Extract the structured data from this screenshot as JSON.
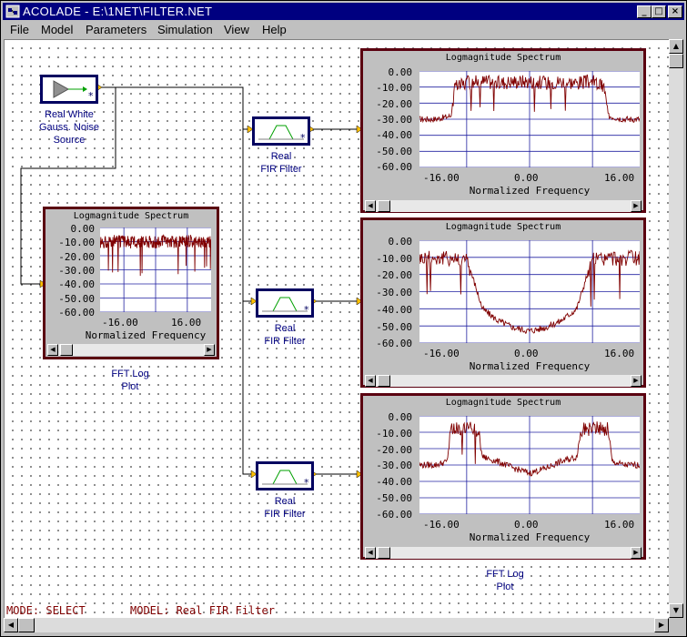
{
  "window": {
    "title": "ACOLADE - E:\\1NET\\FILTER.NET",
    "minimize_glyph": "_",
    "maximize_glyph": "□",
    "close_glyph": "×"
  },
  "menu": {
    "items": [
      "File",
      "Model",
      "Parameters",
      "Simulation",
      "View",
      "Help"
    ]
  },
  "blocks": {
    "noise_source": {
      "label_lines": [
        "Real White",
        "Gauss. Noise",
        "Source"
      ]
    },
    "fir1": {
      "label_lines": [
        "Real",
        "FIR Filter"
      ]
    },
    "fir2": {
      "label_lines": [
        "Real",
        "FIR Filter"
      ]
    },
    "fir3": {
      "label_lines": [
        "Real",
        "FIR Filter"
      ]
    },
    "fft_plot_left": {
      "label_lines": [
        "FFT Log",
        "Plot"
      ]
    },
    "fft_plot_bottom": {
      "label_lines": [
        "FFT Log",
        "Plot"
      ]
    }
  },
  "plot_common": {
    "title": "Logmagnitude Spectrum",
    "xlabel": "Normalized Frequency",
    "ytick_labels": [
      "0.00",
      "-10.00",
      "-20.00",
      "-30.00",
      "-40.00",
      "-50.00",
      "-60.00"
    ],
    "xtick_labels": [
      "-16.00",
      "0.00",
      "16.00"
    ],
    "xtick_labels_small": [
      "-16.00",
      "16.00"
    ]
  },
  "chart_data": [
    {
      "type": "line",
      "title": "Logmagnitude Spectrum",
      "xlabel": "Normalized Frequency",
      "ylabel": "",
      "xlim": [
        -28,
        28
      ],
      "ylim": [
        -60,
        0
      ],
      "grid": true,
      "x": [
        -28,
        -24,
        -20,
        -19,
        -16,
        -12,
        -8,
        -4,
        0,
        4,
        8,
        12,
        16,
        19,
        20,
        24,
        28
      ],
      "series": [
        {
          "values": [
            -30,
            -30,
            -28,
            -10,
            -7,
            -6,
            -7,
            -6,
            -6,
            -7,
            -6,
            -7,
            -6,
            -10,
            -28,
            -30,
            -30
          ]
        }
      ],
      "color": "#800000"
    },
    {
      "type": "line",
      "title": "Logmagnitude Spectrum",
      "xlabel": "Normalized Frequency",
      "ylabel": "",
      "xlim": [
        -28,
        28
      ],
      "ylim": [
        -60,
        0
      ],
      "grid": true,
      "x": [
        -28,
        -20,
        -16,
        -14,
        -12,
        -8,
        -4,
        0,
        4,
        8,
        12,
        14,
        16,
        20,
        28
      ],
      "series": [
        {
          "values": [
            -10,
            -10,
            -11,
            -25,
            -40,
            -47,
            -51,
            -53,
            -51,
            -47,
            -40,
            -25,
            -11,
            -10,
            -10
          ]
        }
      ],
      "color": "#800000"
    },
    {
      "type": "line",
      "title": "Logmagnitude Spectrum",
      "xlabel": "Normalized Frequency",
      "ylabel": "",
      "xlim": [
        -28,
        28
      ],
      "ylim": [
        -60,
        0
      ],
      "grid": true,
      "x": [
        -28,
        -24,
        -21,
        -20,
        -16,
        -13,
        -12,
        -8,
        -4,
        0,
        4,
        8,
        12,
        13,
        16,
        20,
        21,
        24,
        28
      ],
      "series": [
        {
          "values": [
            -30,
            -30,
            -28,
            -8,
            -7,
            -8,
            -25,
            -28,
            -32,
            -35,
            -32,
            -28,
            -25,
            -8,
            -7,
            -8,
            -28,
            -30,
            -30
          ]
        }
      ],
      "color": "#800000"
    },
    {
      "type": "line",
      "title": "Logmagnitude Spectrum",
      "xlabel": "Normalized Frequency",
      "ylabel": "",
      "xlim": [
        -28,
        28
      ],
      "ylim": [
        -60,
        0
      ],
      "grid": true,
      "x": [
        -28,
        -20,
        -12,
        -4,
        0,
        4,
        12,
        20,
        28
      ],
      "series": [
        {
          "values": [
            -10,
            -9,
            -10,
            -9,
            -10,
            -9,
            -10,
            -9,
            -10
          ]
        }
      ],
      "color": "#800000"
    }
  ],
  "status": {
    "mode": "MODE: SELECT",
    "model": "MODEL: Real FIR Filter"
  }
}
